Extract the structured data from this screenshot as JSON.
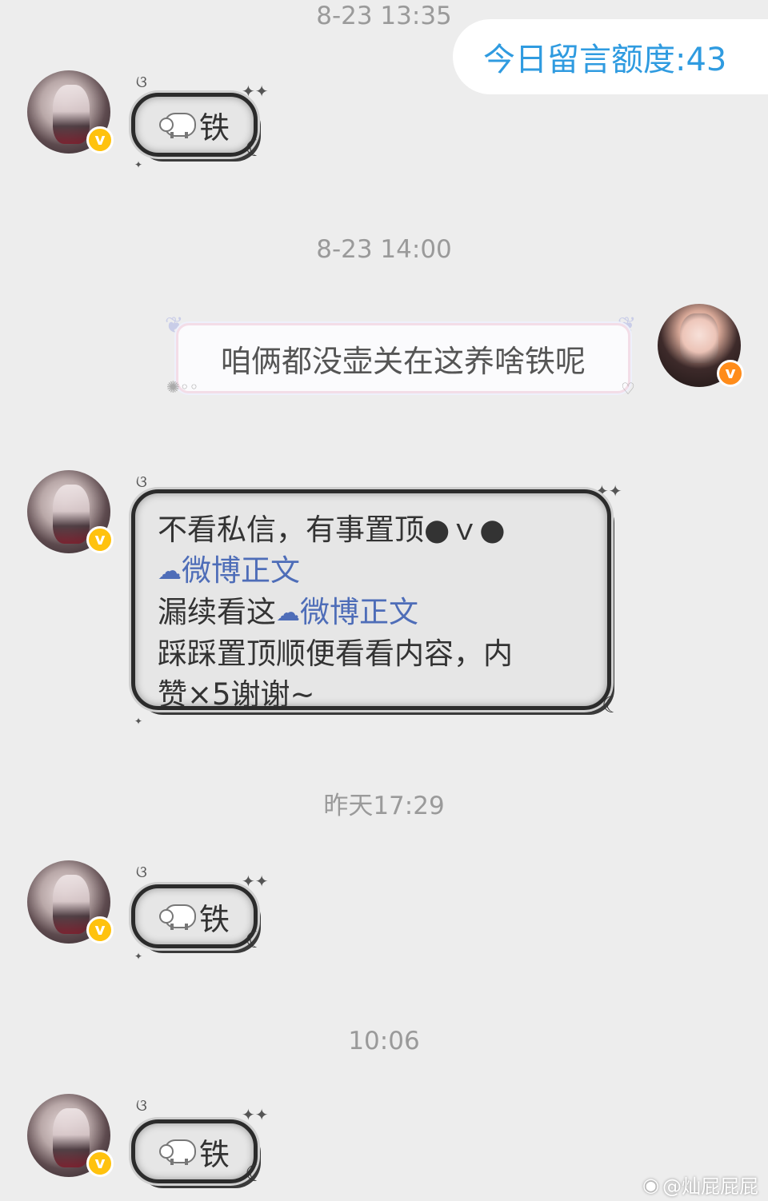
{
  "quota": {
    "label": "今日留言额度:43"
  },
  "watermark": {
    "text": "@灿屁屁屁"
  },
  "messages": [
    {
      "timestamp": "8-23 13:35",
      "text": "铁",
      "icon": "sheep-icon"
    },
    {
      "timestamp": "8-23 14:00",
      "text": "咱俩都没壶关在这养啥铁呢"
    },
    {
      "lines": [
        "不看私信，有事置顶●ｖ●",
        "微博正文",
        "漏续看这",
        "微博正文",
        "踩踩置顶顺便看看内容，内",
        "赞×5谢谢~"
      ]
    },
    {
      "timestamp": "昨天17:29",
      "text": "铁",
      "icon": "sheep-icon"
    },
    {
      "timestamp": "10:06",
      "text": "铁",
      "icon": "sheep-icon"
    }
  ],
  "colors": {
    "background": "#ededed",
    "quota_text": "#2f9be0",
    "link": "#4e6db8",
    "verified_badge": "#ffc20e",
    "verified_badge_self": "#ff8c1a"
  }
}
